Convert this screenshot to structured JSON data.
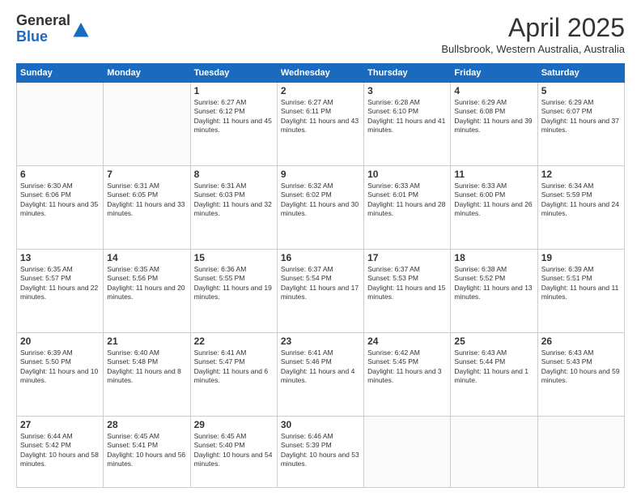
{
  "header": {
    "logo_general": "General",
    "logo_blue": "Blue",
    "month": "April 2025",
    "location": "Bullsbrook, Western Australia, Australia"
  },
  "weekdays": [
    "Sunday",
    "Monday",
    "Tuesday",
    "Wednesday",
    "Thursday",
    "Friday",
    "Saturday"
  ],
  "weeks": [
    [
      {
        "day": "",
        "sunrise": "",
        "sunset": "",
        "daylight": ""
      },
      {
        "day": "",
        "sunrise": "",
        "sunset": "",
        "daylight": ""
      },
      {
        "day": "1",
        "sunrise": "Sunrise: 6:27 AM",
        "sunset": "Sunset: 6:12 PM",
        "daylight": "Daylight: 11 hours and 45 minutes."
      },
      {
        "day": "2",
        "sunrise": "Sunrise: 6:27 AM",
        "sunset": "Sunset: 6:11 PM",
        "daylight": "Daylight: 11 hours and 43 minutes."
      },
      {
        "day": "3",
        "sunrise": "Sunrise: 6:28 AM",
        "sunset": "Sunset: 6:10 PM",
        "daylight": "Daylight: 11 hours and 41 minutes."
      },
      {
        "day": "4",
        "sunrise": "Sunrise: 6:29 AM",
        "sunset": "Sunset: 6:08 PM",
        "daylight": "Daylight: 11 hours and 39 minutes."
      },
      {
        "day": "5",
        "sunrise": "Sunrise: 6:29 AM",
        "sunset": "Sunset: 6:07 PM",
        "daylight": "Daylight: 11 hours and 37 minutes."
      }
    ],
    [
      {
        "day": "6",
        "sunrise": "Sunrise: 6:30 AM",
        "sunset": "Sunset: 6:06 PM",
        "daylight": "Daylight: 11 hours and 35 minutes."
      },
      {
        "day": "7",
        "sunrise": "Sunrise: 6:31 AM",
        "sunset": "Sunset: 6:05 PM",
        "daylight": "Daylight: 11 hours and 33 minutes."
      },
      {
        "day": "8",
        "sunrise": "Sunrise: 6:31 AM",
        "sunset": "Sunset: 6:03 PM",
        "daylight": "Daylight: 11 hours and 32 minutes."
      },
      {
        "day": "9",
        "sunrise": "Sunrise: 6:32 AM",
        "sunset": "Sunset: 6:02 PM",
        "daylight": "Daylight: 11 hours and 30 minutes."
      },
      {
        "day": "10",
        "sunrise": "Sunrise: 6:33 AM",
        "sunset": "Sunset: 6:01 PM",
        "daylight": "Daylight: 11 hours and 28 minutes."
      },
      {
        "day": "11",
        "sunrise": "Sunrise: 6:33 AM",
        "sunset": "Sunset: 6:00 PM",
        "daylight": "Daylight: 11 hours and 26 minutes."
      },
      {
        "day": "12",
        "sunrise": "Sunrise: 6:34 AM",
        "sunset": "Sunset: 5:59 PM",
        "daylight": "Daylight: 11 hours and 24 minutes."
      }
    ],
    [
      {
        "day": "13",
        "sunrise": "Sunrise: 6:35 AM",
        "sunset": "Sunset: 5:57 PM",
        "daylight": "Daylight: 11 hours and 22 minutes."
      },
      {
        "day": "14",
        "sunrise": "Sunrise: 6:35 AM",
        "sunset": "Sunset: 5:56 PM",
        "daylight": "Daylight: 11 hours and 20 minutes."
      },
      {
        "day": "15",
        "sunrise": "Sunrise: 6:36 AM",
        "sunset": "Sunset: 5:55 PM",
        "daylight": "Daylight: 11 hours and 19 minutes."
      },
      {
        "day": "16",
        "sunrise": "Sunrise: 6:37 AM",
        "sunset": "Sunset: 5:54 PM",
        "daylight": "Daylight: 11 hours and 17 minutes."
      },
      {
        "day": "17",
        "sunrise": "Sunrise: 6:37 AM",
        "sunset": "Sunset: 5:53 PM",
        "daylight": "Daylight: 11 hours and 15 minutes."
      },
      {
        "day": "18",
        "sunrise": "Sunrise: 6:38 AM",
        "sunset": "Sunset: 5:52 PM",
        "daylight": "Daylight: 11 hours and 13 minutes."
      },
      {
        "day": "19",
        "sunrise": "Sunrise: 6:39 AM",
        "sunset": "Sunset: 5:51 PM",
        "daylight": "Daylight: 11 hours and 11 minutes."
      }
    ],
    [
      {
        "day": "20",
        "sunrise": "Sunrise: 6:39 AM",
        "sunset": "Sunset: 5:50 PM",
        "daylight": "Daylight: 11 hours and 10 minutes."
      },
      {
        "day": "21",
        "sunrise": "Sunrise: 6:40 AM",
        "sunset": "Sunset: 5:48 PM",
        "daylight": "Daylight: 11 hours and 8 minutes."
      },
      {
        "day": "22",
        "sunrise": "Sunrise: 6:41 AM",
        "sunset": "Sunset: 5:47 PM",
        "daylight": "Daylight: 11 hours and 6 minutes."
      },
      {
        "day": "23",
        "sunrise": "Sunrise: 6:41 AM",
        "sunset": "Sunset: 5:46 PM",
        "daylight": "Daylight: 11 hours and 4 minutes."
      },
      {
        "day": "24",
        "sunrise": "Sunrise: 6:42 AM",
        "sunset": "Sunset: 5:45 PM",
        "daylight": "Daylight: 11 hours and 3 minutes."
      },
      {
        "day": "25",
        "sunrise": "Sunrise: 6:43 AM",
        "sunset": "Sunset: 5:44 PM",
        "daylight": "Daylight: 11 hours and 1 minute."
      },
      {
        "day": "26",
        "sunrise": "Sunrise: 6:43 AM",
        "sunset": "Sunset: 5:43 PM",
        "daylight": "Daylight: 10 hours and 59 minutes."
      }
    ],
    [
      {
        "day": "27",
        "sunrise": "Sunrise: 6:44 AM",
        "sunset": "Sunset: 5:42 PM",
        "daylight": "Daylight: 10 hours and 58 minutes."
      },
      {
        "day": "28",
        "sunrise": "Sunrise: 6:45 AM",
        "sunset": "Sunset: 5:41 PM",
        "daylight": "Daylight: 10 hours and 56 minutes."
      },
      {
        "day": "29",
        "sunrise": "Sunrise: 6:45 AM",
        "sunset": "Sunset: 5:40 PM",
        "daylight": "Daylight: 10 hours and 54 minutes."
      },
      {
        "day": "30",
        "sunrise": "Sunrise: 6:46 AM",
        "sunset": "Sunset: 5:39 PM",
        "daylight": "Daylight: 10 hours and 53 minutes."
      },
      {
        "day": "",
        "sunrise": "",
        "sunset": "",
        "daylight": ""
      },
      {
        "day": "",
        "sunrise": "",
        "sunset": "",
        "daylight": ""
      },
      {
        "day": "",
        "sunrise": "",
        "sunset": "",
        "daylight": ""
      }
    ]
  ]
}
